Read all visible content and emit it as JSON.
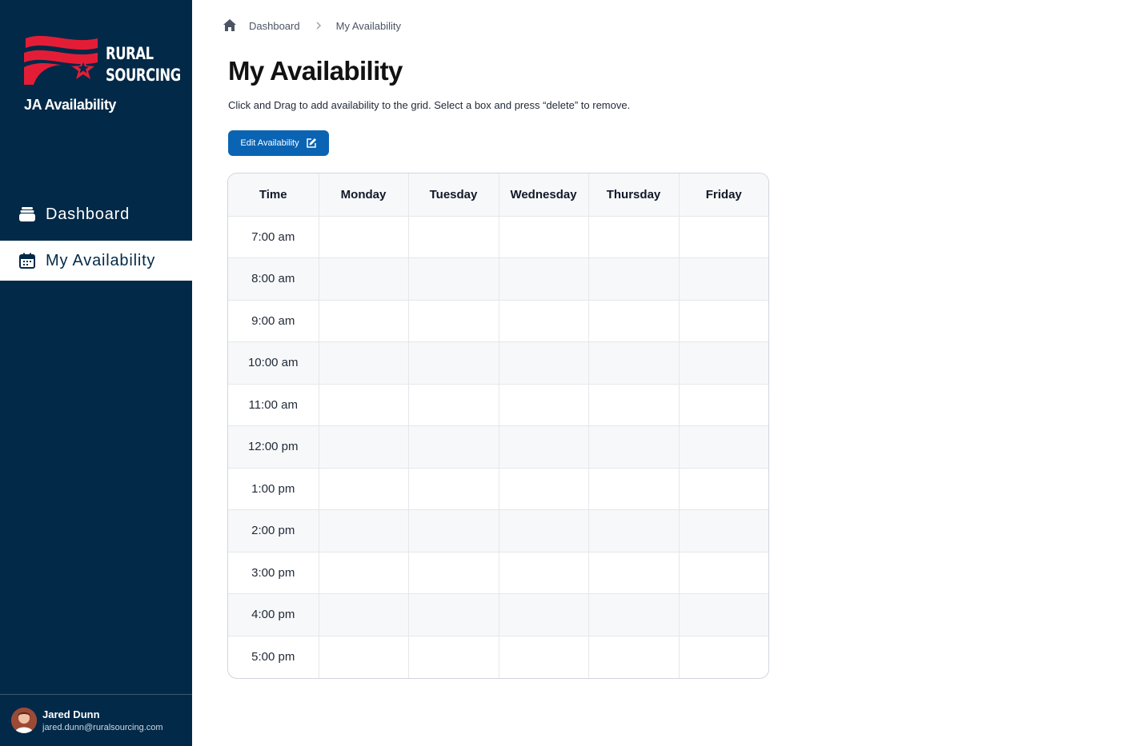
{
  "brand": {
    "logo_line1": "RURAL",
    "logo_line2": "SOURCING",
    "app_name": "JA Availability",
    "sidebar_color": "#022948",
    "flag_red": "#e41d37"
  },
  "sidebar": {
    "items": [
      {
        "label": "Dashboard",
        "icon": "inbox-tray-icon",
        "active": false
      },
      {
        "label": "My Availability",
        "icon": "calendar-icon",
        "active": true
      }
    ]
  },
  "user": {
    "name": "Jared Dunn",
    "email": "jared.dunn@ruralsourcing.com"
  },
  "breadcrumb": {
    "home_icon": "home-icon",
    "items": [
      "Dashboard",
      "My Availability"
    ]
  },
  "page": {
    "title": "My Availability",
    "description": "Click and Drag to add availability to the grid. Select a box and press “delete” to remove.",
    "edit_button_label": "Edit Availability",
    "edit_button_color": "#0a64b3"
  },
  "grid": {
    "headers": [
      "Time",
      "Monday",
      "Tuesday",
      "Wednesday",
      "Thursday",
      "Friday"
    ],
    "times": [
      "7:00 am",
      "8:00 am",
      "9:00 am",
      "10:00 am",
      "11:00 am",
      "12:00 pm",
      "1:00 pm",
      "2:00 pm",
      "3:00 pm",
      "4:00 pm",
      "5:00 pm"
    ]
  }
}
